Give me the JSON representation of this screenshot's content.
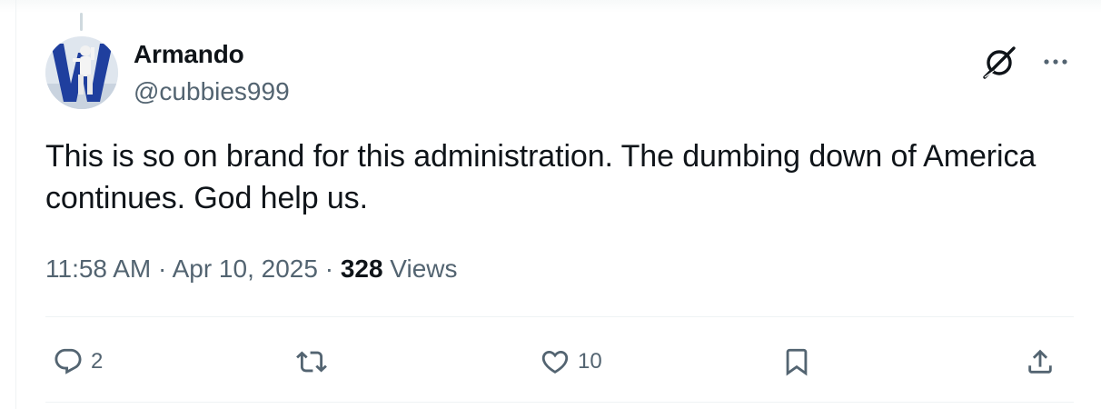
{
  "author": {
    "display_name": "Armando",
    "handle": "@cubbies999"
  },
  "tweet": {
    "text": "This is so on brand for this administration. The dumbing down of America continues. God help us."
  },
  "meta": {
    "time": "11:58 AM",
    "separator1": " · ",
    "date": "Apr 10, 2025",
    "separator2": " · ",
    "view_count": "328",
    "views_label": " Views"
  },
  "actions": {
    "reply_count": "2",
    "like_count": "10"
  },
  "icons": {
    "reply": "reply-icon",
    "retweet": "retweet-icon",
    "like": "heart-icon",
    "bookmark": "bookmark-icon",
    "share": "share-icon",
    "grok": "grok-icon",
    "more": "more-icon"
  },
  "colors": {
    "text": "#0f1419",
    "secondary": "#536471",
    "divider": "#eff3f4"
  }
}
